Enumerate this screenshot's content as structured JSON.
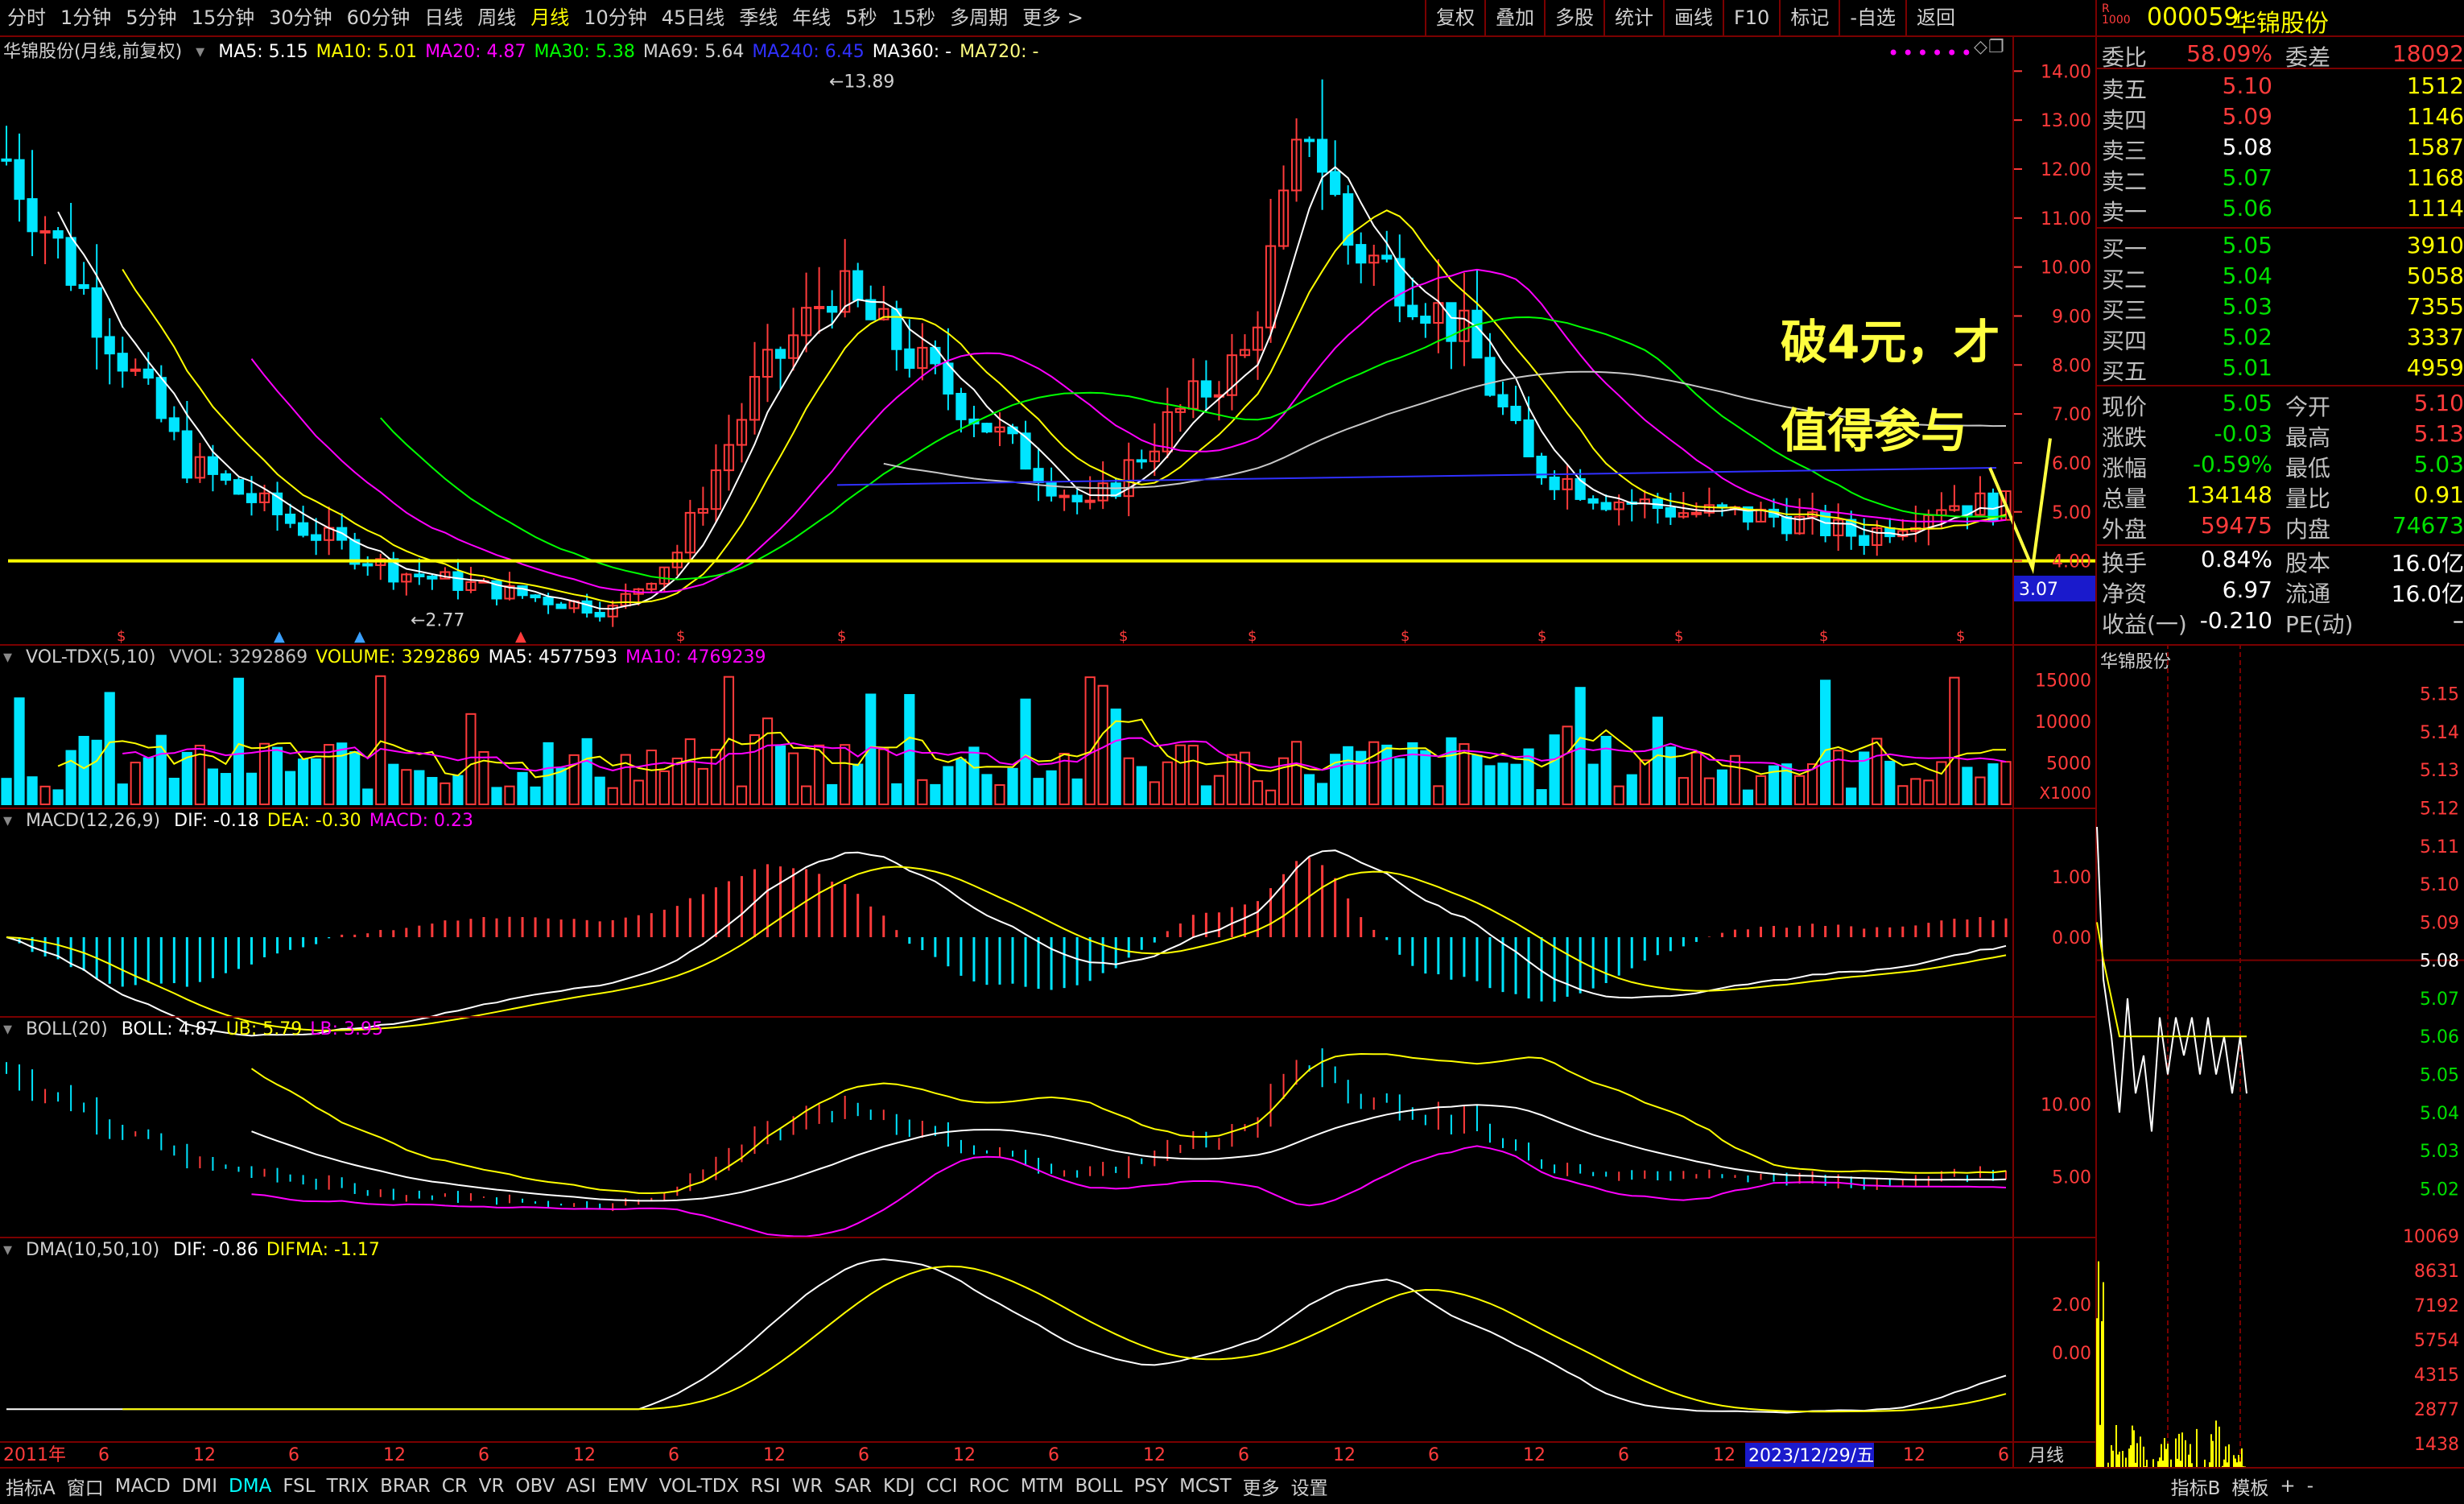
{
  "toolbar": {
    "periods": [
      "分时",
      "1分钟",
      "5分钟",
      "15分钟",
      "30分钟",
      "60分钟",
      "日线",
      "周线",
      "月线",
      "10分钟",
      "45日线",
      "季线",
      "年线",
      "5秒",
      "15秒",
      "多周期",
      "更多 >"
    ],
    "active_period": "月线",
    "right_tools": [
      "复权",
      "叠加",
      "多股",
      "统计",
      "画线",
      "F10",
      "标记",
      "-自选",
      "返回"
    ]
  },
  "main_chart": {
    "title": "华锦股份(月线,前复权)",
    "ma_legend": [
      {
        "text": "MA5: 5.15",
        "color": "#ffffff"
      },
      {
        "text": "MA10: 5.01",
        "color": "#ffff00"
      },
      {
        "text": "MA20: 4.87",
        "color": "#ff00ff"
      },
      {
        "text": "MA30: 5.38",
        "color": "#00ff00"
      },
      {
        "text": "MA69: 5.64",
        "color": "#d0d0d0"
      },
      {
        "text": "MA240: 6.45",
        "color": "#3030ff"
      },
      {
        "text": "MA360: -",
        "color": "#ffffff"
      },
      {
        "text": "MA720: -",
        "color": "#ffff80"
      }
    ],
    "price_axis": [
      "14.00",
      "13.00",
      "12.00",
      "11.00",
      "10.00",
      "9.00",
      "8.00",
      "7.00",
      "6.00",
      "5.00",
      "4.00"
    ],
    "high_label": "13.89",
    "low_label": "2.77",
    "current_tag": "3.07",
    "annotation_line1": "破4元，才",
    "annotation_line2": "值得参与",
    "support_level": 4.0
  },
  "volume_panel": {
    "title": "VOL-TDX(5,10)",
    "legend": [
      {
        "text": "VVOL: 3292869",
        "color": "#c0c0c0"
      },
      {
        "text": "VOLUME: 3292869",
        "color": "#ffff00"
      },
      {
        "text": "MA5: 4577593",
        "color": "#ffffff"
      },
      {
        "text": "MA10: 4769239",
        "color": "#ff00ff"
      }
    ],
    "axis": [
      "15000",
      "10000",
      "5000"
    ],
    "unit": "X1000"
  },
  "macd_panel": {
    "title": "MACD(12,26,9)",
    "legend": [
      {
        "text": "DIF: -0.18",
        "color": "#ffffff"
      },
      {
        "text": "DEA: -0.30",
        "color": "#ffff00"
      },
      {
        "text": "MACD: 0.23",
        "color": "#ff00ff"
      }
    ],
    "axis": [
      "1.00",
      "0.00"
    ]
  },
  "boll_panel": {
    "title": "BOLL(20)",
    "legend": [
      {
        "text": "BOLL: 4.87",
        "color": "#ffffff"
      },
      {
        "text": "UB: 5.79",
        "color": "#ffff00"
      },
      {
        "text": "LB: 3.95",
        "color": "#ff00ff"
      }
    ],
    "axis": [
      "10.00",
      "5.00"
    ]
  },
  "dma_panel": {
    "title": "DMA(10,50,10)",
    "legend": [
      {
        "text": "DIF: -0.86",
        "color": "#ffffff"
      },
      {
        "text": "DIFMA: -1.17",
        "color": "#ffff00"
      }
    ],
    "axis": [
      "2.00",
      "0.00"
    ]
  },
  "time_axis": {
    "labels": [
      "2011年",
      "6",
      "12",
      "6",
      "12",
      "6",
      "12",
      "6",
      "12",
      "6",
      "12",
      "6",
      "12",
      "6",
      "12",
      "6",
      "12",
      "6",
      "12",
      "6",
      "12",
      "6"
    ],
    "cursor_date": "2023/12/29/五",
    "period_label": "月线"
  },
  "quote": {
    "code": "000059",
    "name": "华锦股份",
    "weibi_label": "委比",
    "weibi_value": "58.09%",
    "weicha_label": "委差",
    "weicha_value": "18092",
    "asks": [
      {
        "label": "卖五",
        "price": "5.10",
        "vol": "1512"
      },
      {
        "label": "卖四",
        "price": "5.09",
        "vol": "1146"
      },
      {
        "label": "卖三",
        "price": "5.08",
        "vol": "1587"
      },
      {
        "label": "卖二",
        "price": "5.07",
        "vol": "1168"
      },
      {
        "label": "卖一",
        "price": "5.06",
        "vol": "1114"
      }
    ],
    "bids": [
      {
        "label": "买一",
        "price": "5.05",
        "vol": "3910"
      },
      {
        "label": "买二",
        "price": "5.04",
        "vol": "5058"
      },
      {
        "label": "买三",
        "price": "5.03",
        "vol": "7355"
      },
      {
        "label": "买四",
        "price": "5.02",
        "vol": "3337"
      },
      {
        "label": "买五",
        "price": "5.01",
        "vol": "4959"
      }
    ],
    "stats": [
      {
        "l1": "现价",
        "v1": "5.05",
        "c1": "green",
        "l2": "今开",
        "v2": "5.10",
        "c2": "red"
      },
      {
        "l1": "涨跌",
        "v1": "-0.03",
        "c1": "green",
        "l2": "最高",
        "v2": "5.13",
        "c2": "red"
      },
      {
        "l1": "涨幅",
        "v1": "-0.59%",
        "c1": "green",
        "l2": "最低",
        "v2": "5.03",
        "c2": "green"
      },
      {
        "l1": "总量",
        "v1": "134148",
        "c1": "yellow",
        "l2": "量比",
        "v2": "0.91",
        "c2": "yellow"
      },
      {
        "l1": "外盘",
        "v1": "59475",
        "c1": "red",
        "l2": "内盘",
        "v2": "74673",
        "c2": "green"
      }
    ],
    "stats2": [
      {
        "l1": "换手",
        "v1": "0.84%",
        "l2": "股本",
        "v2": "16.0亿"
      },
      {
        "l1": "净资",
        "v1": "6.97",
        "l2": "流通",
        "v2": "16.0亿"
      },
      {
        "l1": "收益(一)",
        "v1": "-0.210",
        "l2": "PE(动)",
        "v2": "–"
      }
    ]
  },
  "intraday": {
    "title": "华锦股份",
    "price_axis": [
      "5.15",
      "5.14",
      "5.13",
      "5.12",
      "5.11",
      "5.10",
      "5.09",
      "5.08",
      "5.07",
      "5.06",
      "5.05",
      "5.04",
      "5.03",
      "5.02"
    ],
    "volume_axis": [
      "10069",
      "8631",
      "7192",
      "5754",
      "4315",
      "2877",
      "1438"
    ]
  },
  "bottom_tabs": [
    "指标A",
    "窗口",
    "MACD",
    "DMI",
    "DMA",
    "FSL",
    "TRIX",
    "BRAR",
    "CR",
    "VR",
    "OBV",
    "ASI",
    "EMV",
    "VOL-TDX",
    "RSI",
    "WR",
    "SAR",
    "KDJ",
    "CCI",
    "ROC",
    "MTM",
    "BOLL",
    "PSY",
    "MCST",
    "更多",
    "设置"
  ],
  "bottom_active": "DMA",
  "bottom_right": [
    "指标B",
    "模板",
    "+",
    "-"
  ],
  "colors": {
    "up": "#ff3b3b",
    "down": "#00e5ff",
    "grid": "#7a0000",
    "support": "#ffff00"
  }
}
